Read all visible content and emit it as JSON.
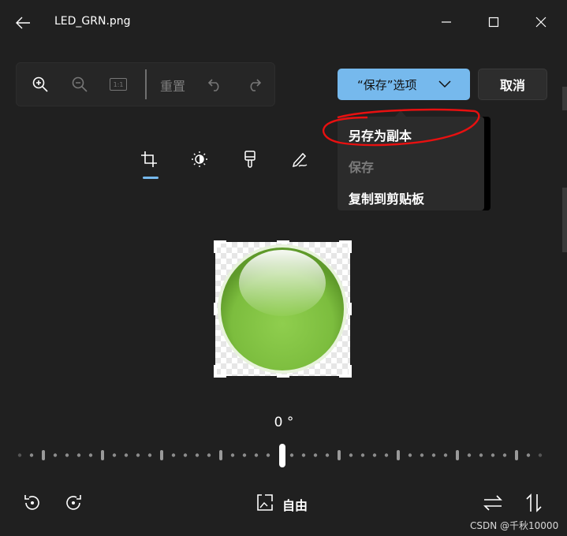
{
  "window": {
    "title": "LED_GRN.png",
    "back_icon": "arrow-left-icon",
    "controls": [
      "minimize-icon",
      "maximize-icon",
      "close-icon"
    ]
  },
  "toolbar": {
    "icons": [
      "zoom-in-icon",
      "zoom-out-icon",
      "actual-size-icon",
      "undo-icon",
      "redo-icon"
    ],
    "actual_size_label": "1:1",
    "reset_label": "重置"
  },
  "save_options": {
    "label": "“保存”选项",
    "accent": "#76b9ed"
  },
  "cancel_label": "取消",
  "edit_modes": [
    {
      "name": "crop-icon",
      "selected": true
    },
    {
      "name": "brightness-icon",
      "selected": false
    },
    {
      "name": "brush-icon",
      "selected": false
    },
    {
      "name": "markup-pen-icon",
      "selected": false
    }
  ],
  "dropdown": {
    "items": [
      {
        "label": "另存为副本",
        "enabled": true
      },
      {
        "label": "保存",
        "enabled": false
      },
      {
        "label": "复制到剪贴板",
        "enabled": true
      }
    ],
    "annotation_color": "#e81010"
  },
  "image": {
    "subject": "green-led-sphere",
    "color": "#80c040"
  },
  "rotation": {
    "angle": "0 °",
    "value_degrees": 0
  },
  "bottom": {
    "rotate_left_icon": "rotate-left-icon",
    "rotate_right_icon": "rotate-right-icon",
    "aspect_icon": "aspect-ratio-icon",
    "aspect_label": "自由",
    "flip_horizontal_icon": "flip-horizontal-icon",
    "flip_vertical_icon": "flip-vertical-icon"
  },
  "watermark": "CSDN @千秋10000"
}
